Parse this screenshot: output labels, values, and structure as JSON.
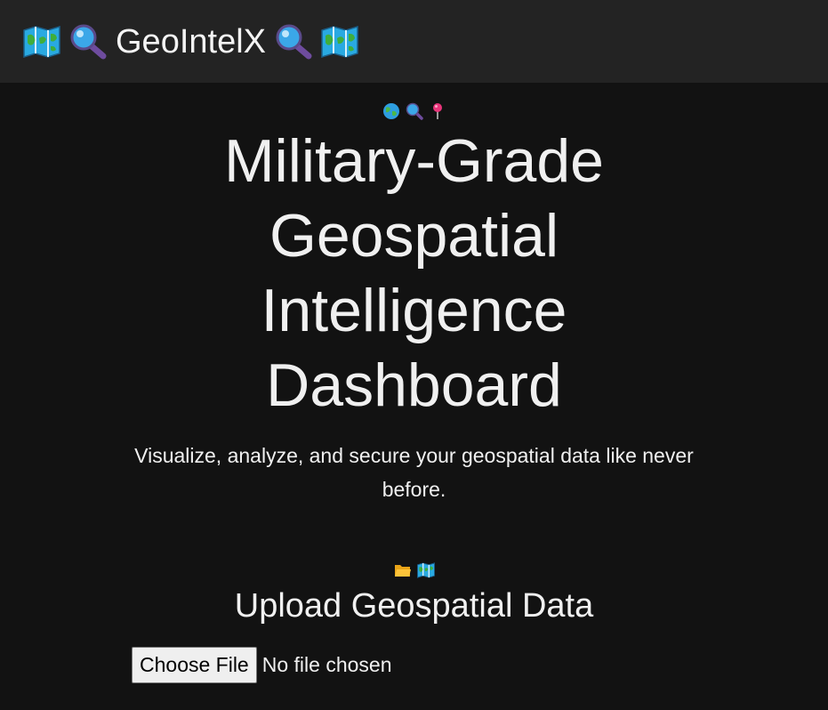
{
  "header": {
    "brand_name": "GeoIntelX",
    "left_icons": [
      "map-icon",
      "magnifier-icon"
    ],
    "right_icons": [
      "magnifier-icon",
      "map-icon"
    ]
  },
  "hero": {
    "icons": [
      "globe-icon",
      "magnifier-icon",
      "pin-icon"
    ],
    "title": "Military-Grade Geospatial Intelligence Dashboard",
    "subtitle": "Visualize, analyze, and secure your geospatial data like never before."
  },
  "upload": {
    "icons": [
      "folder-icon",
      "map-icon"
    ],
    "title": "Upload Geospatial Data",
    "button_label": "Choose File",
    "file_status": "No file chosen"
  },
  "colors": {
    "background": "#121212",
    "header_background": "#232323",
    "text": "#f0f0f0"
  }
}
